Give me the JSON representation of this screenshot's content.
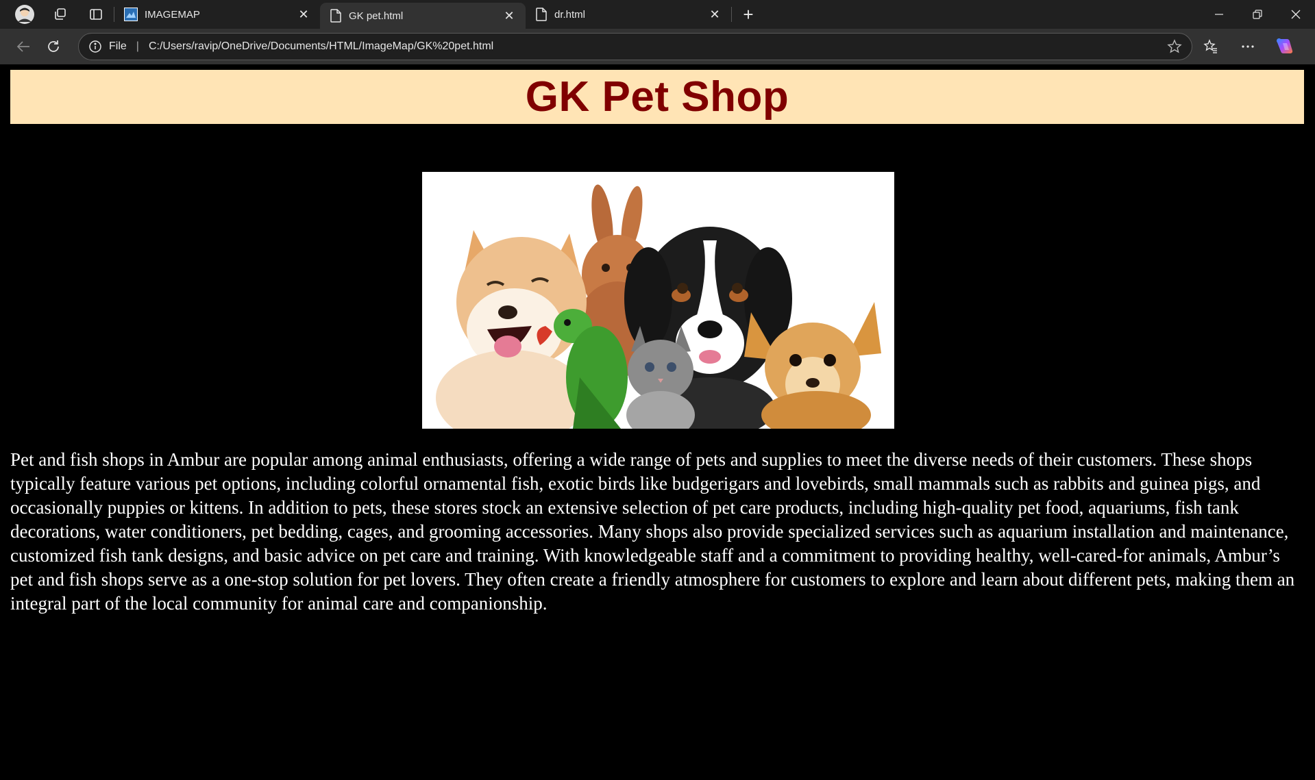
{
  "browser": {
    "tabs": [
      {
        "label": "IMAGEMAP",
        "active": false
      },
      {
        "label": "GK pet.html",
        "active": true
      },
      {
        "label": "dr.html",
        "active": false
      }
    ],
    "address": {
      "scheme_label": "File",
      "url": "C:/Users/ravip/OneDrive/Documents/HTML/ImageMap/GK%20pet.html"
    }
  },
  "page": {
    "title": "GK Pet Shop",
    "description": "Pet and fish shops in Ambur are popular among animal enthusiasts, offering a wide range of pets and supplies to meet the diverse needs of their customers. These shops typically feature various pet options, including colorful ornamental fish, exotic birds like budgerigars and lovebirds, small mammals such as rabbits and guinea pigs, and occasionally puppies or kittens. In addition to pets, these stores stock an extensive selection of pet care products, including high-quality pet food, aquariums, fish tank decorations, water conditioners, pet bedding, cages, and grooming accessories. Many shops also provide specialized services such as aquarium installation and maintenance, customized fish tank designs, and basic advice on pet care and training. With knowledgeable staff and a commitment to providing healthy, well-cared-for animals, Ambur’s pet and fish shops serve as a one-stop solution for pet lovers. They often create a friendly atmosphere for customers to explore and learn about different pets, making them an integral part of the local community for animal care and companionship."
  },
  "colors": {
    "header_bg": "#ffe4b5",
    "title_color": "#800000",
    "page_bg": "#000000",
    "text_color": "#ffffff"
  }
}
